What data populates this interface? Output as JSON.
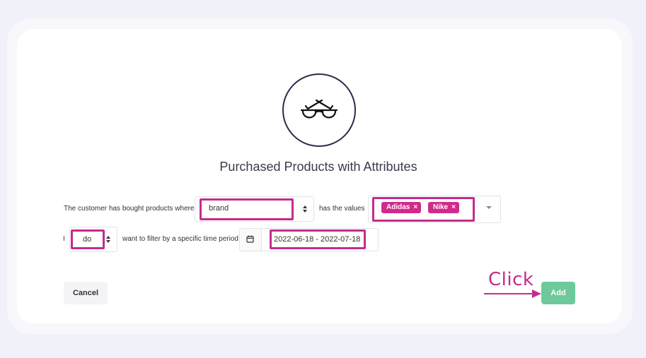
{
  "dialog": {
    "title": "Purchased Products with Attributes",
    "icon": "sunglasses-icon"
  },
  "row1": {
    "prefix": "The customer has bought products where",
    "attribute_value": "brand",
    "middle": "has the values",
    "tags": [
      "Adidas",
      "Nike"
    ],
    "tag_remove": "×"
  },
  "row2": {
    "prefix": "I",
    "do_value": "do",
    "middle": "want to filter by a specific time period",
    "date_range": "2022-06-18 - 2022-07-18"
  },
  "buttons": {
    "cancel": "Cancel",
    "add": "Add"
  },
  "annotation": {
    "text": "Click",
    "color": "#c22d8c"
  },
  "colors": {
    "accent": "#d12a8b",
    "add_button": "#6ec99a",
    "highlight": "#c22d8c"
  }
}
